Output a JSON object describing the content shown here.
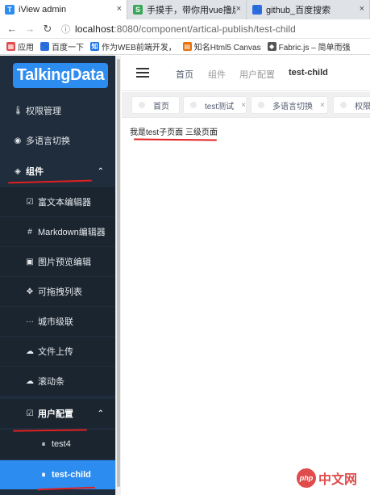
{
  "browser": {
    "tabs": [
      {
        "title": "iView admin",
        "favicon": "T",
        "favicon_color": "#2d8cf0",
        "active": true
      },
      {
        "title": "手摸手，带你用vue撸后",
        "favicon": "S",
        "favicon_color": "#3aa757",
        "active": false
      },
      {
        "title": "github_百度搜索",
        "favicon": "🐾",
        "favicon_color": "#2f6de1",
        "active": false
      }
    ],
    "close_glyph": "×",
    "url_host": "localhost",
    "url_path": ":8080/component/artical-publish/test-child",
    "bookmarks": [
      {
        "label": "应用",
        "icon_color": "#e04b4b",
        "icon": "▦"
      },
      {
        "label": "百度一下",
        "icon_color": "#2f6de1",
        "icon": "🐾"
      },
      {
        "label": "作为WEB前端开发，",
        "icon_color": "#1a73e8",
        "icon": "知"
      },
      {
        "label": "知名Html5 Canvas",
        "icon_color": "#e8710a",
        "icon": "▤"
      },
      {
        "label": "Fabric.js – 简单而强",
        "icon_color": "#555555",
        "icon": "◆"
      }
    ]
  },
  "sidebar": {
    "logo": "TalkingData",
    "items": [
      {
        "label": "权限管理",
        "icon": "🌡",
        "level": "top"
      },
      {
        "label": "多语言切换",
        "icon": "◉",
        "level": "top"
      },
      {
        "label": "组件",
        "icon": "◈",
        "level": "top",
        "open": true,
        "chev": "⌃"
      },
      {
        "label": "富文本编辑器",
        "icon": "☑",
        "level": "sub"
      },
      {
        "label": "Markdown编辑器",
        "icon": "#",
        "level": "sub"
      },
      {
        "label": "图片预览编辑",
        "icon": "▣",
        "level": "sub"
      },
      {
        "label": "可拖拽列表",
        "icon": "✥",
        "level": "sub"
      },
      {
        "label": "城市级联",
        "icon": "···",
        "level": "sub"
      },
      {
        "label": "文件上传",
        "icon": "☁",
        "level": "sub"
      },
      {
        "label": "滚动条",
        "icon": "☁",
        "level": "sub"
      },
      {
        "label": "用户配置",
        "icon": "☑",
        "level": "sub",
        "open": true,
        "chev": "⌃"
      },
      {
        "label": "test4",
        "icon": "⏸",
        "level": "sub2"
      },
      {
        "label": "test-child",
        "icon": "⏸",
        "level": "sub2",
        "selected": true
      }
    ]
  },
  "header": {
    "breadcrumb": [
      "首页",
      "组件",
      "用户配置",
      "test-child"
    ]
  },
  "tags": [
    {
      "label": "首页",
      "closable": false
    },
    {
      "label": "test测试",
      "closable": true
    },
    {
      "label": "多语言切换",
      "closable": true
    },
    {
      "label": "权限",
      "closable": false
    }
  ],
  "content": {
    "text": "我是test子页面 三级页面"
  },
  "watermark": {
    "php": "php",
    "cn": "中文网"
  },
  "colors": {
    "accent": "#2d8cf0",
    "sidebar_bg": "#1f2d3d",
    "annotation": "#e02020"
  }
}
